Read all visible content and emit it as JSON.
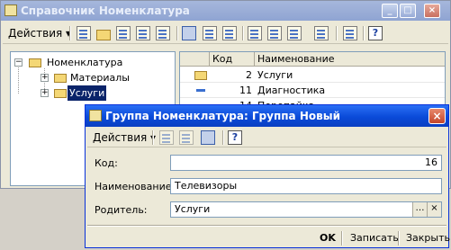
{
  "main_window": {
    "title": "Справочник Номенклатура",
    "toolbar": {
      "actions_label": "Действия"
    },
    "tree": {
      "root": "Номенклатура",
      "items": [
        {
          "label": "Материалы",
          "selected": false
        },
        {
          "label": "Услуги",
          "selected": true
        }
      ]
    },
    "list": {
      "columns": [
        "Код",
        "Наименование"
      ],
      "rows": [
        {
          "code": "2",
          "name": "Услуги",
          "type": "folder"
        },
        {
          "code": "11",
          "name": "Диагностика",
          "type": "item"
        },
        {
          "code": "14",
          "name": "Перепайка...",
          "type": "item"
        }
      ]
    }
  },
  "dialog": {
    "title": "Группа Номенклатура: Группа Новый",
    "toolbar": {
      "actions_label": "Действия"
    },
    "fields": {
      "code": {
        "label": "Код:",
        "value": "16"
      },
      "name": {
        "label": "Наименование:",
        "value": "Телевизоры"
      },
      "parent": {
        "label": "Родитель:",
        "value": "Услуги"
      }
    },
    "buttons": {
      "ok": "OK",
      "save": "Записать",
      "close": "Закрыть"
    }
  },
  "colors": {
    "dialog_title": "#0a4ad8",
    "selection": "#0a246a",
    "inactive_title": "#a6b7dc"
  },
  "icons": [
    "app-icon",
    "folder-icon",
    "element-icon",
    "help-icon",
    "close-icon",
    "select-icon",
    "clear-icon"
  ]
}
